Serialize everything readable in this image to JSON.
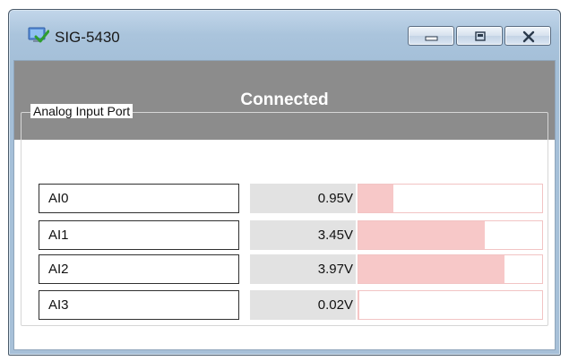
{
  "window": {
    "title": "SIG-5430"
  },
  "status": {
    "text": "Connected",
    "background": "#8c8c8c"
  },
  "analog": {
    "group_label": "Analog Input Port",
    "full_scale_volts": 5.0,
    "bar_color": "#f7c8c8",
    "ports": [
      {
        "name": "AI0",
        "value": "0.95V",
        "volts": 0.95
      },
      {
        "name": "AI1",
        "value": "3.45V",
        "volts": 3.45
      },
      {
        "name": "AI2",
        "value": "3.97V",
        "volts": 3.97
      },
      {
        "name": "AI3",
        "value": "0.02V",
        "volts": 0.02
      }
    ]
  },
  "icons": {
    "app": "app-check-icon",
    "minimize": "minimize-icon",
    "maximize": "maximize-icon",
    "close": "close-icon"
  }
}
